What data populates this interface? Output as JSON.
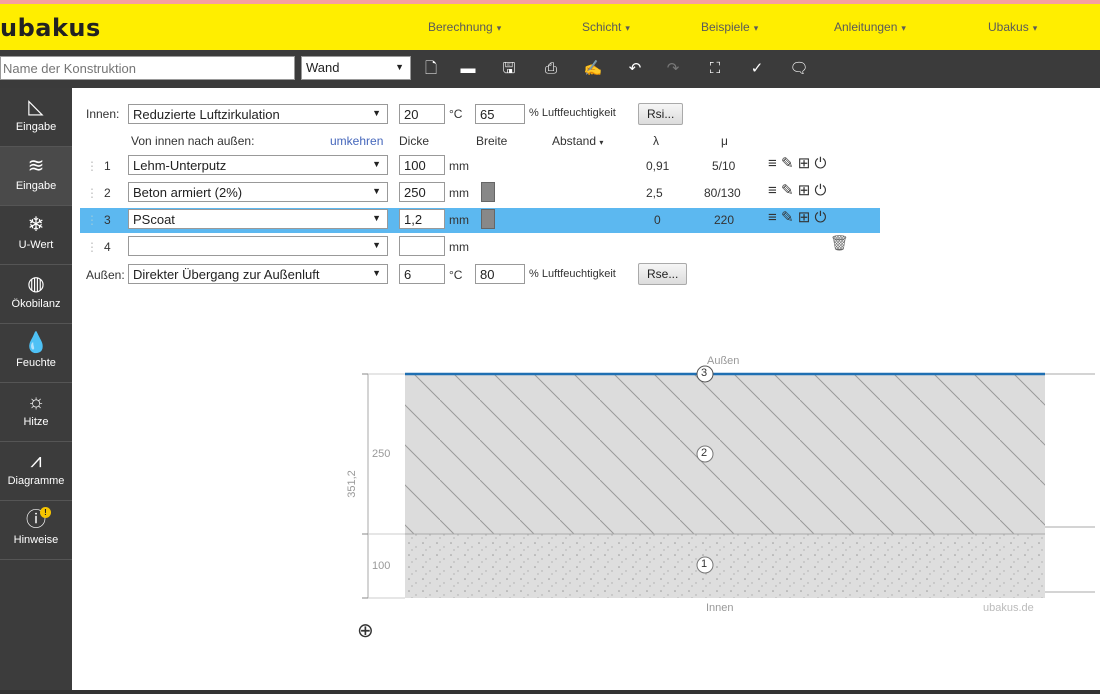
{
  "app": {
    "logo": "ubakus"
  },
  "menu": [
    {
      "label": "Berechnung"
    },
    {
      "label": "Schicht"
    },
    {
      "label": "Beispiele"
    },
    {
      "label": "Anleitungen"
    },
    {
      "label": "Ubakus"
    }
  ],
  "toolbar": {
    "name_placeholder": "Name der Konstruktion",
    "type_value": "Wand",
    "icons": [
      "new-file-icon",
      "open-folder-icon",
      "save-icon",
      "pdf-icon",
      "edit-icon",
      "undo-icon",
      "redo-icon",
      "fullscreen-icon",
      "tools-icon",
      "comment-icon"
    ]
  },
  "sidebar": [
    {
      "label": "Eingabe",
      "icon": "drafting-icon"
    },
    {
      "label": "Eingabe",
      "icon": "layers-icon"
    },
    {
      "label": "U-Wert",
      "icon": "thermometer-icon"
    },
    {
      "label": "Ökobilanz",
      "icon": "globe-icon"
    },
    {
      "label": "Feuchte",
      "icon": "droplet-icon"
    },
    {
      "label": "Hitze",
      "icon": "sun-icon"
    },
    {
      "label": "Diagramme",
      "icon": "chart-icon"
    },
    {
      "label": "Hinweise",
      "icon": "warning-icon",
      "badge": "!"
    }
  ],
  "inside": {
    "label": "Innen:",
    "select": "Reduzierte Luftzirkulation",
    "temp": "20",
    "temp_unit": "°C",
    "humidity": "65",
    "humidity_unit": "% Luftfeuchtigkeit",
    "button": "Rsi..."
  },
  "headers": {
    "direction": "Von innen nach außen:",
    "reverse": "umkehren",
    "thickness": "Dicke",
    "width": "Breite",
    "spacing": "Abstand",
    "lambda": "λ",
    "mu": "μ"
  },
  "layers": [
    {
      "num": "1",
      "material": "Lehm-Unterputz",
      "thickness": "100",
      "unit": "mm",
      "lambda": "0,91",
      "mu": "5/10"
    },
    {
      "num": "2",
      "material": "Beton armiert (2%)",
      "thickness": "250",
      "unit": "mm",
      "lambda": "2,5",
      "mu": "80/130"
    },
    {
      "num": "3",
      "material": "PScoat",
      "thickness": "1,2",
      "unit": "mm",
      "lambda": "0",
      "mu": "220"
    },
    {
      "num": "4",
      "material": "",
      "thickness": "",
      "unit": "mm",
      "lambda": "",
      "mu": ""
    }
  ],
  "outside": {
    "label": "Außen:",
    "select": "Direkter Übergang zur Außenluft",
    "temp": "6",
    "temp_unit": "°C",
    "humidity": "80",
    "humidity_unit": "% Luftfeuchtigkeit",
    "button": "Rse..."
  },
  "drawing": {
    "top_label": "Außen",
    "bottom_label": "Innen",
    "watermark": "ubakus.de",
    "total_dim": "351,2",
    "dim_concrete": "250",
    "dim_plaster": "100",
    "markers": [
      "3",
      "2",
      "1"
    ],
    "colors": {
      "layer_fill": "#d8d8d8",
      "coat_line": "#1f6fb2"
    }
  }
}
